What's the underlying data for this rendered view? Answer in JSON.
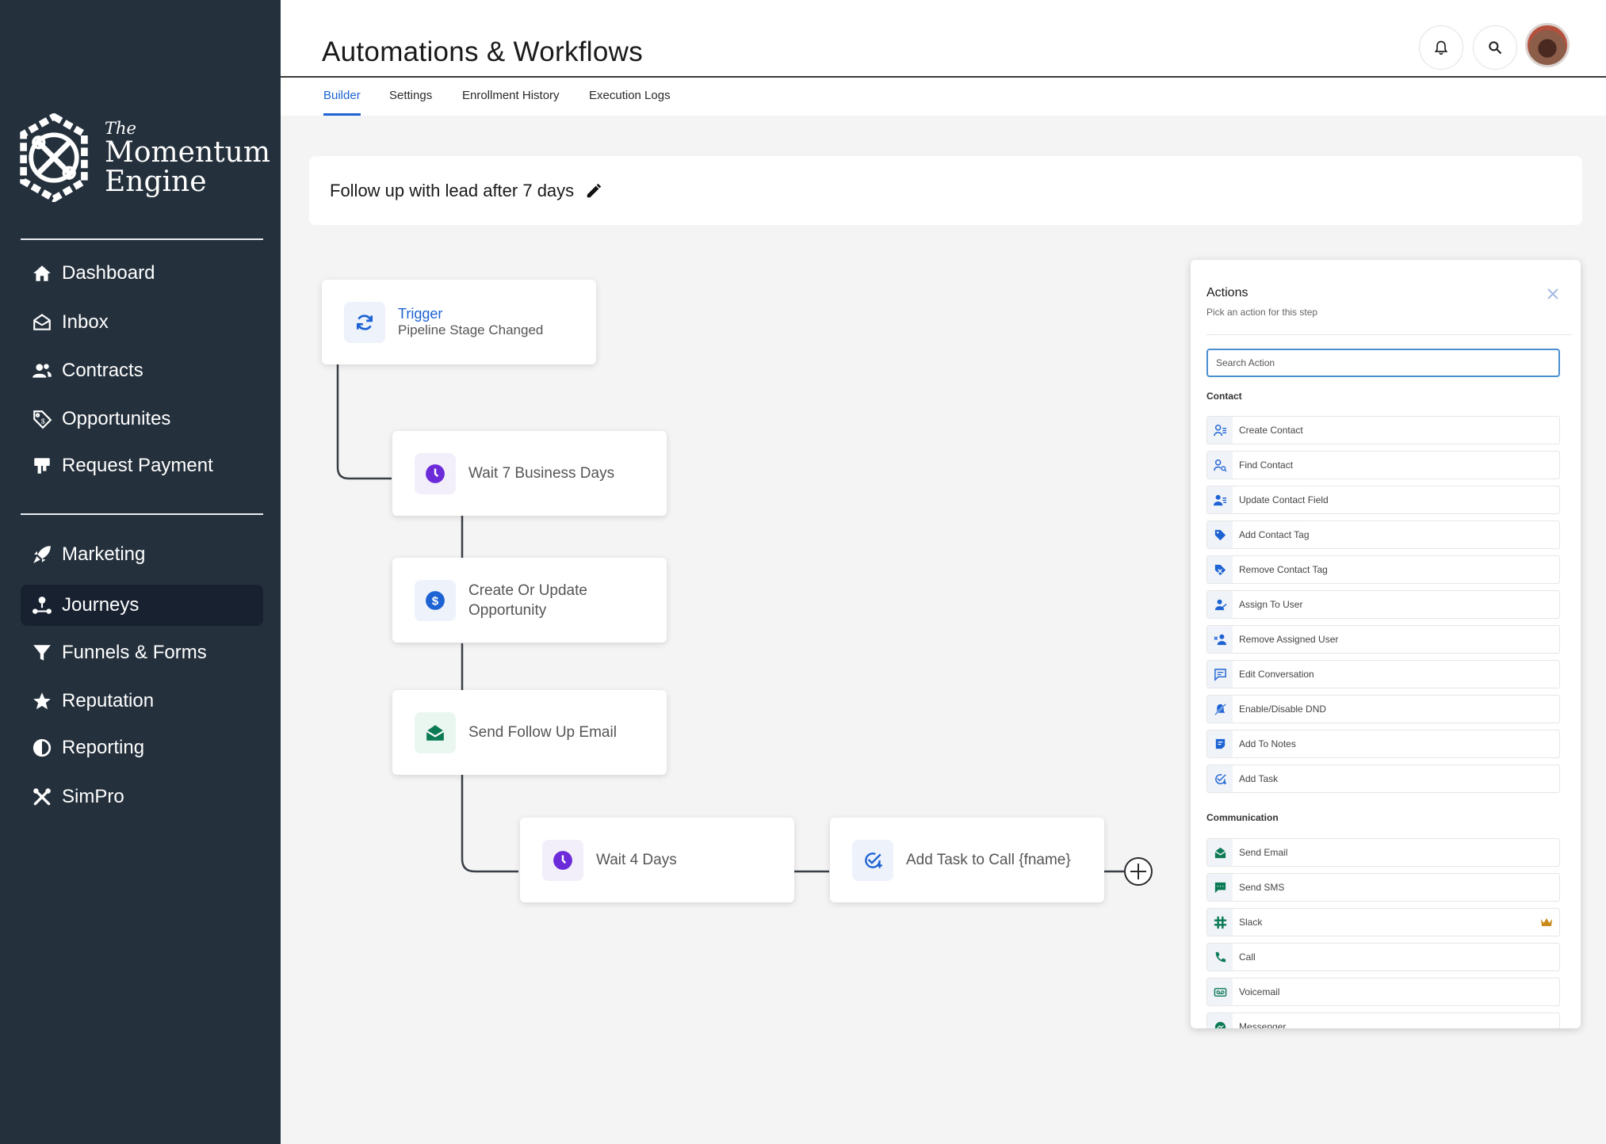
{
  "brand": {
    "small": "The",
    "line1": "Momentum",
    "line2": "Engine"
  },
  "sidebar": {
    "items": [
      {
        "label": "Dashboard",
        "icon": "home-icon"
      },
      {
        "label": "Inbox",
        "icon": "inbox-icon"
      },
      {
        "label": "Contracts",
        "icon": "contacts-icon"
      },
      {
        "label": "Opportunites",
        "icon": "tag-dollar-icon"
      },
      {
        "label": "Request Payment",
        "icon": "payment-icon"
      },
      {
        "label": "Marketing",
        "icon": "rocket-icon"
      },
      {
        "label": "Journeys",
        "icon": "journey-icon",
        "active": true
      },
      {
        "label": "Funnels & Forms",
        "icon": "funnel-icon"
      },
      {
        "label": "Reputation",
        "icon": "star-icon"
      },
      {
        "label": "Reporting",
        "icon": "pie-icon"
      },
      {
        "label": "SimPro",
        "icon": "tools-icon"
      }
    ]
  },
  "header": {
    "title": "Automations & Workflows"
  },
  "tabs": [
    "Builder",
    "Settings",
    "Enrollment History",
    "Execution Logs"
  ],
  "workflow": {
    "name": "Follow up with lead after 7 days"
  },
  "nodes": {
    "trigger": {
      "title": "Trigger",
      "subtitle": "Pipeline Stage Changed"
    },
    "wait1": "Wait 7 Business Days",
    "opportunity_line1": "Create Or Update",
    "opportunity_line2": "Opportunity",
    "email": "Send Follow Up Email",
    "wait2": "Wait 4 Days",
    "task": "Add Task to Call {fname}"
  },
  "panel": {
    "title": "Actions",
    "subtitle": "Pick an action for this step",
    "search_placeholder": "Search Action",
    "contact_label": "Contact",
    "contact_actions": [
      "Create Contact",
      "Find Contact",
      "Update Contact Field",
      "Add Contact Tag",
      "Remove Contact Tag",
      "Assign To User",
      "Remove Assigned User",
      "Edit Conversation",
      "Enable/Disable DND",
      "Add To Notes",
      "Add Task"
    ],
    "communication_label": "Communication",
    "communication_actions": [
      "Send Email",
      "Send SMS",
      "Slack",
      "Call",
      "Voicemail",
      "Messenger"
    ]
  },
  "colors": {
    "sidebar": "#25303d",
    "accent": "#1e63d3",
    "wait_icon": "#6c2bd9",
    "email_icon": "#0b7a55"
  }
}
